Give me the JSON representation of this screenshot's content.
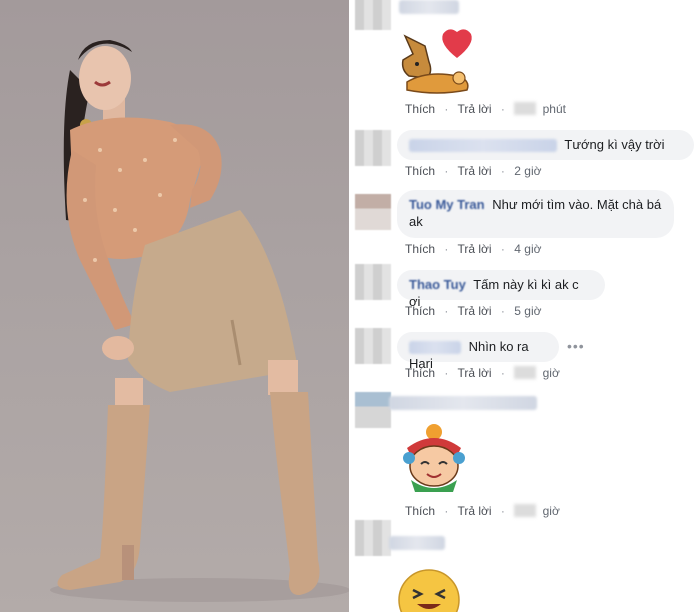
{
  "comments": [
    {
      "text": "",
      "action_like": "Thích",
      "action_reply": "Trả lời",
      "time": "phút"
    },
    {
      "text": "Tướng kì vậy trời",
      "action_like": "Thích",
      "action_reply": "Trả lời",
      "time": "2 giờ"
    },
    {
      "name": "Tuo My Tran",
      "text": "Như mới tìm vào. Mặt chà bá",
      "text2": "ak",
      "action_like": "Thích",
      "action_reply": "Trả lời",
      "time": "4 giờ"
    },
    {
      "name": "Thao Tuy",
      "text": "Tấm này kì kì ak c ơi",
      "action_like": "Thích",
      "action_reply": "Trả lời",
      "time": "5 giờ"
    },
    {
      "text": "Nhìn ko ra Hari",
      "more": "•••",
      "action_like": "Thích",
      "action_reply": "Trả lời",
      "time": "giờ"
    },
    {
      "text": "",
      "action_like": "Thích",
      "action_reply": "Trả lời",
      "time": "giờ"
    }
  ],
  "separator": "·",
  "stickers": {
    "first": "dog-and-heart-sticker",
    "second": "monkey-king-sticker",
    "third": "laughing-face-sticker"
  },
  "colors": {
    "bubble_bg": "#f2f3f5",
    "name_blue": "#385898",
    "action_gray": "#616770",
    "photo_bg": "#a8a0a0",
    "boots": "#c9a485",
    "skirt": "#c6aa8c",
    "top": "#d59b78"
  }
}
